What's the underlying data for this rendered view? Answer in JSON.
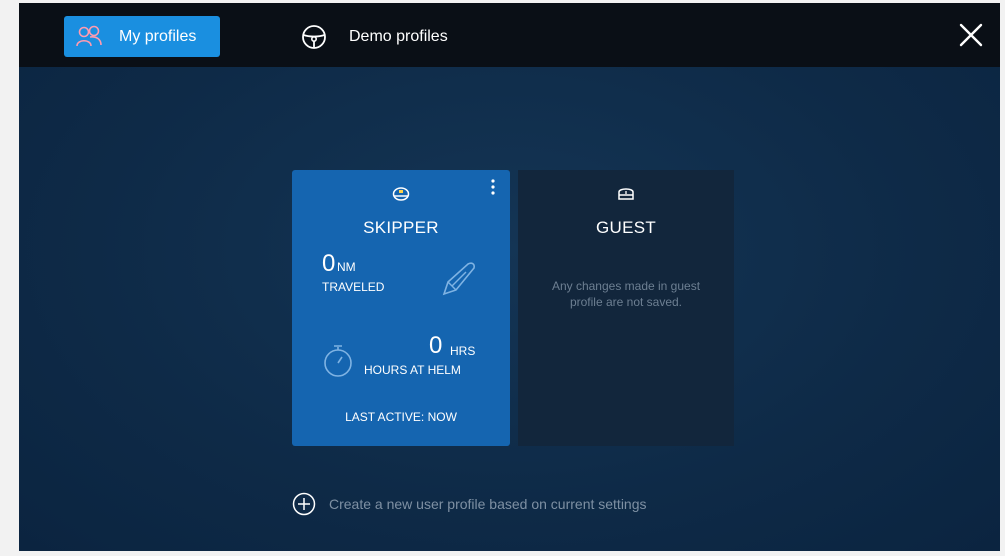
{
  "tabs": [
    {
      "label": "My profiles",
      "icon": "users-icon",
      "active": true
    },
    {
      "label": "Demo profiles",
      "icon": "steering-wheel-icon",
      "active": false
    }
  ],
  "close_icon": "close-icon",
  "profiles": {
    "skipper": {
      "title": "SKIPPER",
      "icon": "captain-hat-icon",
      "distance_value": "0",
      "distance_unit": "NM",
      "distance_label": "TRAVELED",
      "hours_value": "0",
      "hours_unit": "HRS",
      "hours_label": "HOURS AT HELM",
      "last_active": "LAST ACTIVE: NOW"
    },
    "guest": {
      "title": "GUEST",
      "icon": "guest-hat-icon",
      "message": "Any changes made in guest profile are not saved."
    }
  },
  "create_profile_label": "Create a new user profile based on current settings",
  "colors": {
    "accent": "#1a8fe0",
    "skipper_card": "#1565b0",
    "background": "#0e2a47",
    "topbar": "#0a0f16"
  }
}
